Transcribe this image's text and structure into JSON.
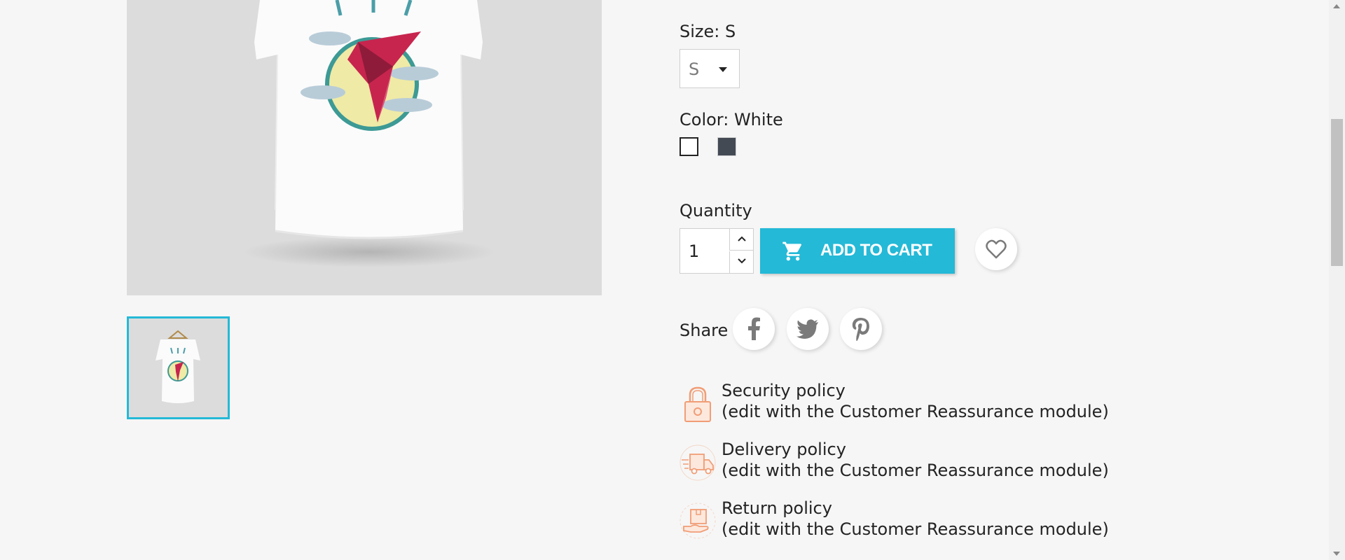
{
  "product": {
    "size_label": "Size: S",
    "size_select_value": "S",
    "color_label": "Color: White",
    "colors": [
      {
        "name": "White",
        "hex": "#ffffff",
        "selected": true
      },
      {
        "name": "Black",
        "hex": "#434a54",
        "selected": false
      }
    ],
    "quantity_label": "Quantity",
    "quantity_value": "1",
    "add_to_cart_label": "ADD TO CART",
    "share_label": "Share"
  },
  "reassurance": [
    {
      "title": "Security policy",
      "subtitle": "(edit with the Customer Reassurance module)",
      "icon": "lock-icon"
    },
    {
      "title": "Delivery policy",
      "subtitle": "(edit with the Customer Reassurance module)",
      "icon": "delivery-truck-icon"
    },
    {
      "title": "Return policy",
      "subtitle": "(edit with the Customer Reassurance module)",
      "icon": "return-package-icon"
    }
  ],
  "colors": {
    "accent": "#24b9d7",
    "background": "#f6f6f6",
    "icon_orange": "#f19d76"
  }
}
